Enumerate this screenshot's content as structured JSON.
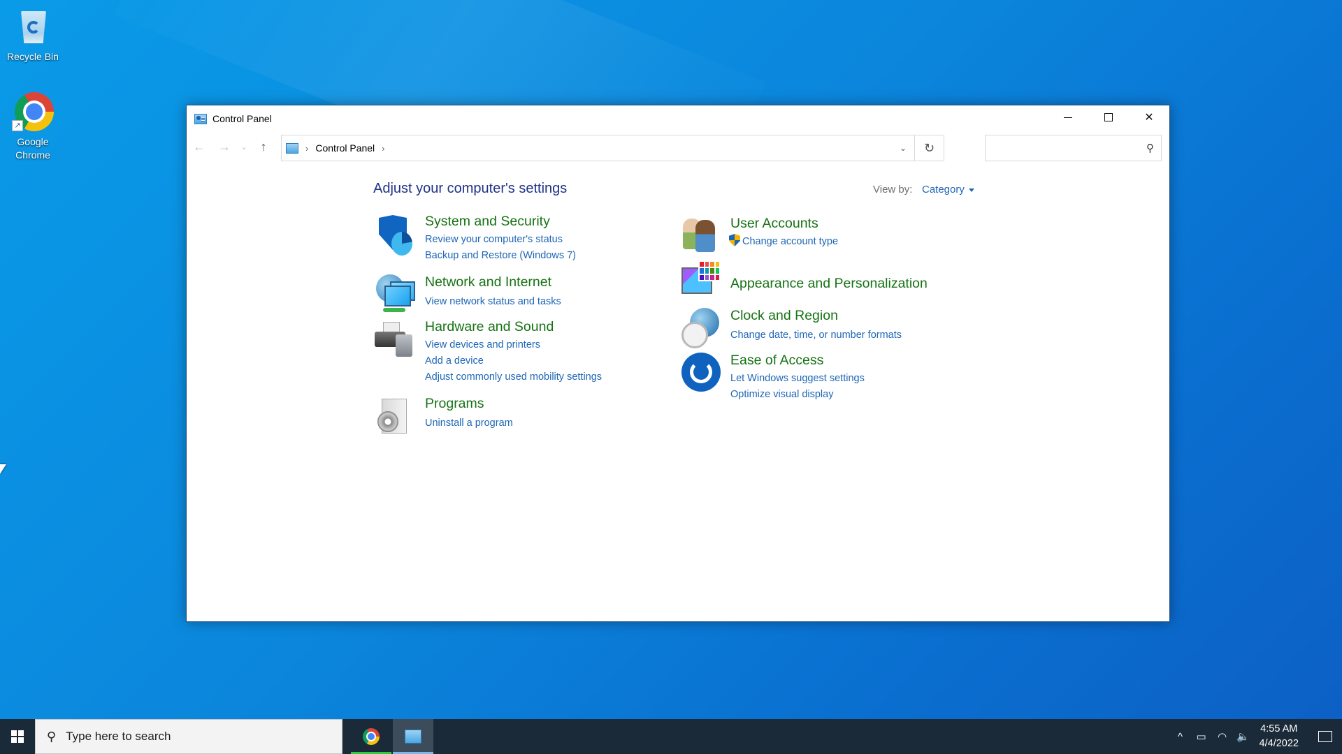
{
  "desktop": {
    "icons": [
      {
        "label": "Recycle Bin",
        "icon": "recycle-bin-icon"
      },
      {
        "label": "Google Chrome",
        "icon": "chrome-icon"
      }
    ]
  },
  "window": {
    "title": "Control Panel",
    "controls": {
      "minimize": "minimize",
      "maximize": "maximize",
      "close": "✕"
    },
    "nav": {
      "back": "←",
      "forward": "→",
      "recent": "⌄",
      "up": "↑"
    },
    "address": {
      "breadcrumb": [
        "Control Panel"
      ],
      "dropdown": "⌄",
      "refresh": "↻"
    },
    "search": {
      "value": "",
      "placeholder": "",
      "icon": "⚲"
    }
  },
  "content": {
    "heading": "Adjust your computer's settings",
    "view_by_label": "View by:",
    "view_by_value": "Category",
    "categories": [
      {
        "title": "System and Security",
        "links": [
          "Review your computer's status",
          "Backup and Restore (Windows 7)"
        ]
      },
      {
        "title": "Network and Internet",
        "links": [
          "View network status and tasks"
        ]
      },
      {
        "title": "Hardware and Sound",
        "links": [
          "View devices and printers",
          "Add a device",
          "Adjust commonly used mobility settings"
        ]
      },
      {
        "title": "Programs",
        "links": [
          "Uninstall a program"
        ]
      },
      {
        "title": "User Accounts",
        "links": [
          "Change account type"
        ]
      },
      {
        "title": "Appearance and Personalization",
        "links": []
      },
      {
        "title": "Clock and Region",
        "links": [
          "Change date, time, or number formats"
        ]
      },
      {
        "title": "Ease of Access",
        "links": [
          "Let Windows suggest settings",
          "Optimize visual display"
        ]
      }
    ]
  },
  "taskbar": {
    "search_placeholder": "Type here to search",
    "apps": [
      {
        "name": "Google Chrome",
        "indicator_color": "#2ecc40"
      },
      {
        "name": "Control Panel",
        "indicator_color": "#7fb8e6"
      }
    ],
    "tray": {
      "chevron": "^",
      "battery": "▭",
      "wifi": "◠",
      "volume": "🔈"
    },
    "time": "4:55 AM",
    "date": "4/4/2022"
  },
  "colors": {
    "category_title": "#167214",
    "link": "#1e66b5",
    "heading": "#1e3287"
  }
}
